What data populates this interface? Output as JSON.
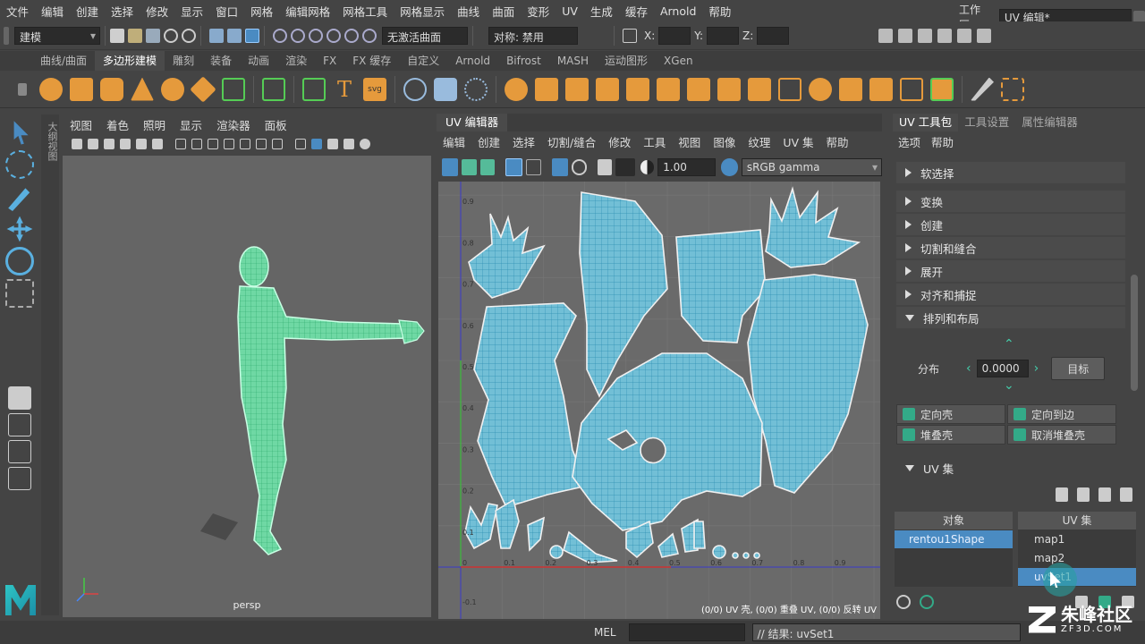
{
  "menubar": {
    "items": [
      "文件",
      "编辑",
      "创建",
      "选择",
      "修改",
      "显示",
      "窗口",
      "网格",
      "编辑网格",
      "网格工具",
      "网格显示",
      "曲线",
      "曲面",
      "变形",
      "UV",
      "生成",
      "缓存",
      "Arnold",
      "帮助"
    ],
    "workspace_label": "工作区:",
    "workspace_value": "UV 编辑*"
  },
  "statusline": {
    "mode_select": "建模",
    "live_surface": "无激活曲面",
    "symmetry": "对称: 禁用",
    "x_label": "X:",
    "y_label": "Y:",
    "z_label": "Z:"
  },
  "shelf": {
    "tabs": [
      "曲线/曲面",
      "多边形建模",
      "雕刻",
      "装备",
      "动画",
      "渲染",
      "FX",
      "FX 缓存",
      "自定义",
      "Arnold",
      "Bifrost",
      "MASH",
      "运动图形",
      "XGen"
    ],
    "active_tab": 1
  },
  "viewport": {
    "menu": [
      "视图",
      "着色",
      "照明",
      "显示",
      "渲染器",
      "面板"
    ],
    "camera_label": "persp",
    "side_label": "大纲视图"
  },
  "uv_editor": {
    "title": "UV 编辑器",
    "menu": [
      "编辑",
      "创建",
      "选择",
      "切割/缝合",
      "修改",
      "工具",
      "视图",
      "图像",
      "纹理",
      "UV 集",
      "帮助"
    ],
    "exposure_value": "1.00",
    "color_space": "sRGB gamma",
    "grid_x_labels": [
      "0",
      "0.1",
      "0.2",
      "0.3",
      "0.4",
      "0.5",
      "0.6",
      "0.7",
      "0.8",
      "0.9"
    ],
    "grid_y_labels": [
      "0.9",
      "0.8",
      "0.7",
      "0.6",
      "0.5",
      "0.4",
      "0.3",
      "0.2",
      "0.1"
    ],
    "grid_neg_label": "-0.1",
    "status_text": "(0/0) UV 壳, (0/0) 重叠 UV, (0/0) 反转 UV"
  },
  "uv_toolkit": {
    "tabs": [
      "UV 工具包",
      "工具设置",
      "属性编辑器"
    ],
    "menu": [
      "选项",
      "帮助"
    ],
    "sections": [
      "软选择",
      "变换",
      "创建",
      "切割和缝合",
      "展开",
      "对齐和捕捉"
    ],
    "layout_section": "排列和布局",
    "distribute_label": "分布",
    "distribute_value": "0.0000",
    "target_button": "目标",
    "buttons": [
      "定向壳",
      "定向到边",
      "堆叠壳",
      "取消堆叠壳"
    ],
    "uvset_section": "UV 集",
    "object_header": "对象",
    "uvset_header": "UV 集",
    "object_item": "rentou1Shape",
    "uvsets": [
      "map1",
      "map2",
      "uvSet1"
    ],
    "selected_uvset": 2
  },
  "bottom": {
    "mel_label": "MEL",
    "result_text": "// 结果: uvSet1"
  },
  "watermark": {
    "brand": "朱峰社区",
    "url": "ZF3D.COM"
  },
  "colors": {
    "uv_mesh": "#5ec8e6",
    "model_wire": "#3fdf95",
    "selection": "#4a8bc2",
    "accent_orange": "#e59a3c"
  }
}
